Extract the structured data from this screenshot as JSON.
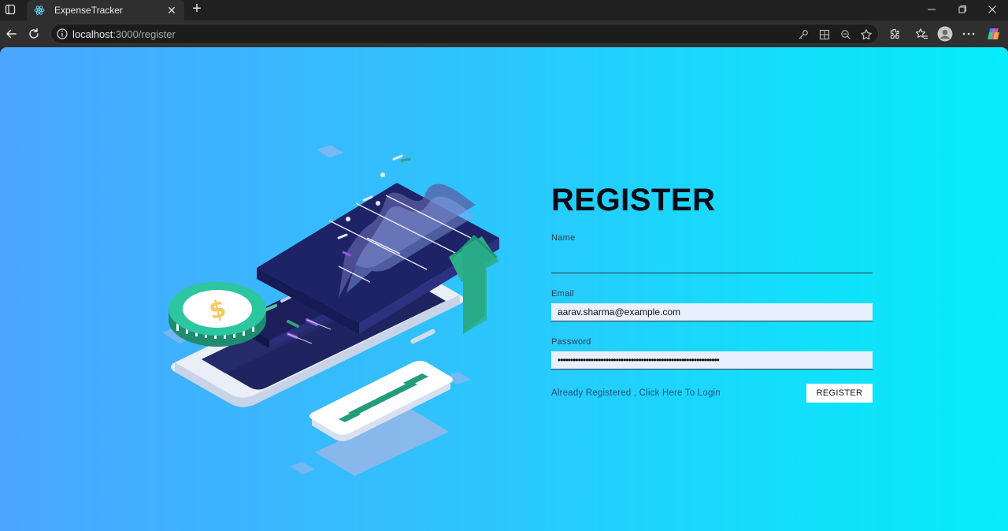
{
  "browser": {
    "tab_title": "ExpenseTracker",
    "url_host": "localhost",
    "url_path": ":3000/register"
  },
  "form": {
    "heading": "REGISTER",
    "name_label": "Name",
    "name_value": "",
    "email_label": "Email",
    "email_value": "aarav.sharma@example.com",
    "password_label": "Password",
    "password_value": "••••••••••••••••••••••••••••••••••••••••••••••••••••••••••••••••",
    "login_link": "Already Registered , Click Here To Login",
    "register_button": "REGISTER"
  },
  "colors": {
    "gradient_left": "#4aa6ff",
    "gradient_right": "#05ecfa",
    "heading": "#050a14"
  },
  "icons": [
    "sidebar-toggle-icon",
    "react-favicon-icon",
    "close-icon",
    "plus-icon",
    "back-icon",
    "reload-icon",
    "info-icon",
    "key-icon",
    "apps-icon",
    "zoom-out-icon",
    "star-icon",
    "extensions-icon",
    "favorites-icon",
    "profile-icon",
    "more-icon",
    "copilot-icon"
  ]
}
